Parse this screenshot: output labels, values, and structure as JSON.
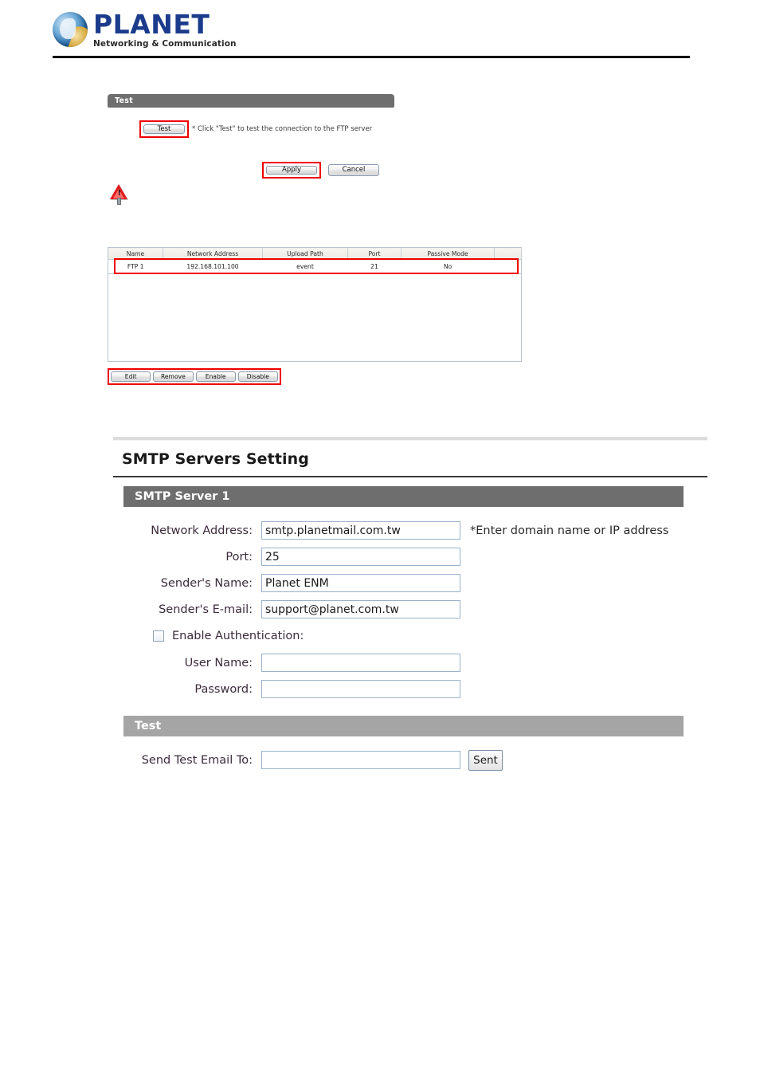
{
  "header": {
    "brand": "PLANET",
    "tagline": "Networking & Communication"
  },
  "ftp_test_panel": {
    "section_title": "Test",
    "test_button": "Test",
    "hint": "* Click \"Test\" to test the connection to the FTP server",
    "apply_button": "Apply",
    "cancel_button": "Cancel",
    "warning_icon": "warning-triangle-icon"
  },
  "ftp_list": {
    "columns": [
      "Name",
      "Network Address",
      "Upload Path",
      "Port",
      "Passive Mode",
      ""
    ],
    "rows": [
      {
        "name": "FTP 1",
        "network_address": "192.168.101.100",
        "upload_path": "event",
        "port": "21",
        "passive_mode": "No",
        "extra": ""
      }
    ],
    "buttons": [
      "Edit",
      "Remove",
      "Enable",
      "Disable"
    ]
  },
  "smtp": {
    "page_title": "SMTP Servers Setting",
    "server_section": "SMTP Server 1",
    "fields": {
      "network_address": {
        "label": "Network Address:",
        "value": "smtp.planetmail.com.tw",
        "note": "*Enter domain name or IP address"
      },
      "port": {
        "label": "Port:",
        "value": "25"
      },
      "sender_name": {
        "label": "Sender's Name:",
        "value": "Planet ENM"
      },
      "sender_email": {
        "label": "Sender's E-mail:",
        "value": "support@planet.com.tw"
      },
      "enable_auth": {
        "label": "Enable Authentication:",
        "checked": false
      },
      "user_name": {
        "label": "User Name:",
        "value": ""
      },
      "password": {
        "label": "Password:",
        "value": ""
      }
    },
    "test_section": {
      "title": "Test",
      "label": "Send Test Email To:",
      "value": "",
      "button": "Sent"
    }
  },
  "colors": {
    "highlight": "#ef0000",
    "section_dark": "#6e6e6e",
    "section_light": "#a5a5a5",
    "brand_blue": "#1b3c8c"
  }
}
